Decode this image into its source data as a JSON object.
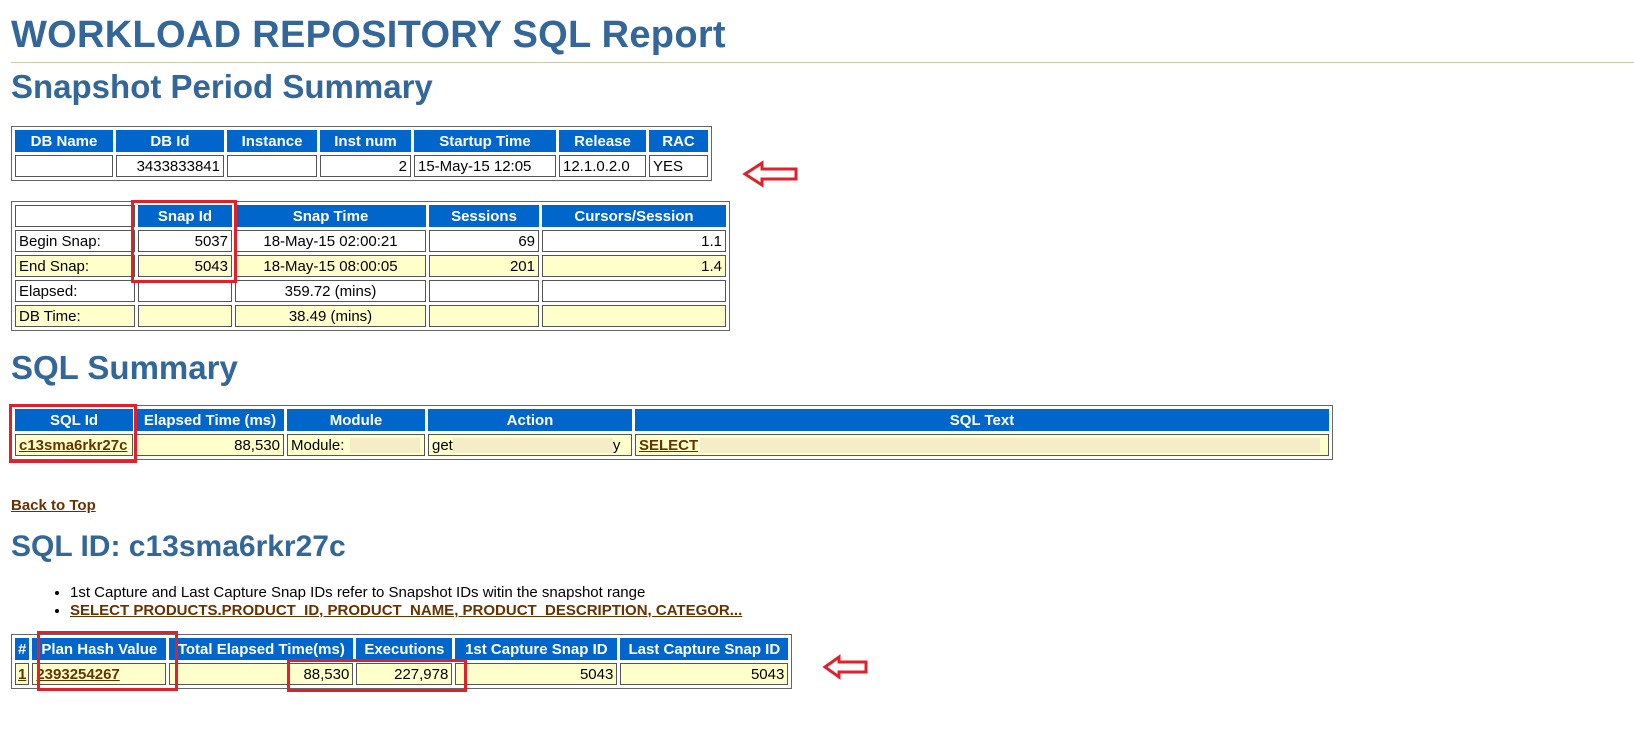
{
  "report": {
    "title": "WORKLOAD REPOSITORY SQL Report",
    "section_snapshot": "Snapshot Period Summary",
    "section_sql_summary": "SQL Summary",
    "section_sql_id": "SQL ID: c13sma6rkr27c"
  },
  "db_info": {
    "headers": [
      "DB Name",
      "DB Id",
      "Instance",
      "Inst num",
      "Startup Time",
      "Release",
      "RAC"
    ],
    "row": {
      "db_name": "",
      "db_id": "3433833841",
      "instance": "",
      "inst_num": "2",
      "startup_time": "15-May-15 12:05",
      "release": "12.1.0.2.0",
      "rac": "YES"
    }
  },
  "snapshots": {
    "headers": [
      "",
      "Snap Id",
      "Snap Time",
      "Sessions",
      "Cursors/Session"
    ],
    "rows": [
      {
        "label": "Begin Snap:",
        "snap_id": "5037",
        "snap_time": "18-May-15 02:00:21",
        "sessions": "69",
        "cursors": "1.1"
      },
      {
        "label": "End Snap:",
        "snap_id": "5043",
        "snap_time": "18-May-15 08:00:05",
        "sessions": "201",
        "cursors": "1.4"
      },
      {
        "label": "Elapsed:",
        "snap_id": "",
        "snap_time": "359.72 (mins)",
        "sessions": "",
        "cursors": ""
      },
      {
        "label": "DB Time:",
        "snap_id": "",
        "snap_time": "38.49 (mins)",
        "sessions": "",
        "cursors": ""
      }
    ]
  },
  "sql_summary": {
    "headers": [
      "SQL Id",
      "Elapsed Time (ms)",
      "Module",
      "Action",
      "SQL Text"
    ],
    "row": {
      "sql_id": "c13sma6rkr27c",
      "elapsed": "88,530",
      "module": "Module:",
      "action_start": "get",
      "action_end": "y",
      "sql_text": "SELECT"
    }
  },
  "back_to_top": "Back to Top",
  "notes": [
    "1st Capture and Last Capture Snap IDs refer to Snapshot IDs witin the snapshot range",
    "SELECT PRODUCTS.PRODUCT_ID, PRODUCT_NAME, PRODUCT_DESCRIPTION, CATEGOR..."
  ],
  "plans": {
    "headers": [
      "#",
      "Plan Hash Value",
      "Total Elapsed Time(ms)",
      "Executions",
      "1st Capture Snap ID",
      "Last Capture Snap ID"
    ],
    "row": {
      "num": "1",
      "plan_hash": "2393254267",
      "total_elapsed": "88,530",
      "executions": "227,978",
      "first_snap": "5043",
      "last_snap": "5043"
    }
  },
  "annotation_colors": {
    "highlight": "#e0202a",
    "header_bg": "#0066cc",
    "row_alt_bg": "#ffffcc",
    "title_color": "#336699",
    "link_color": "#663300"
  }
}
